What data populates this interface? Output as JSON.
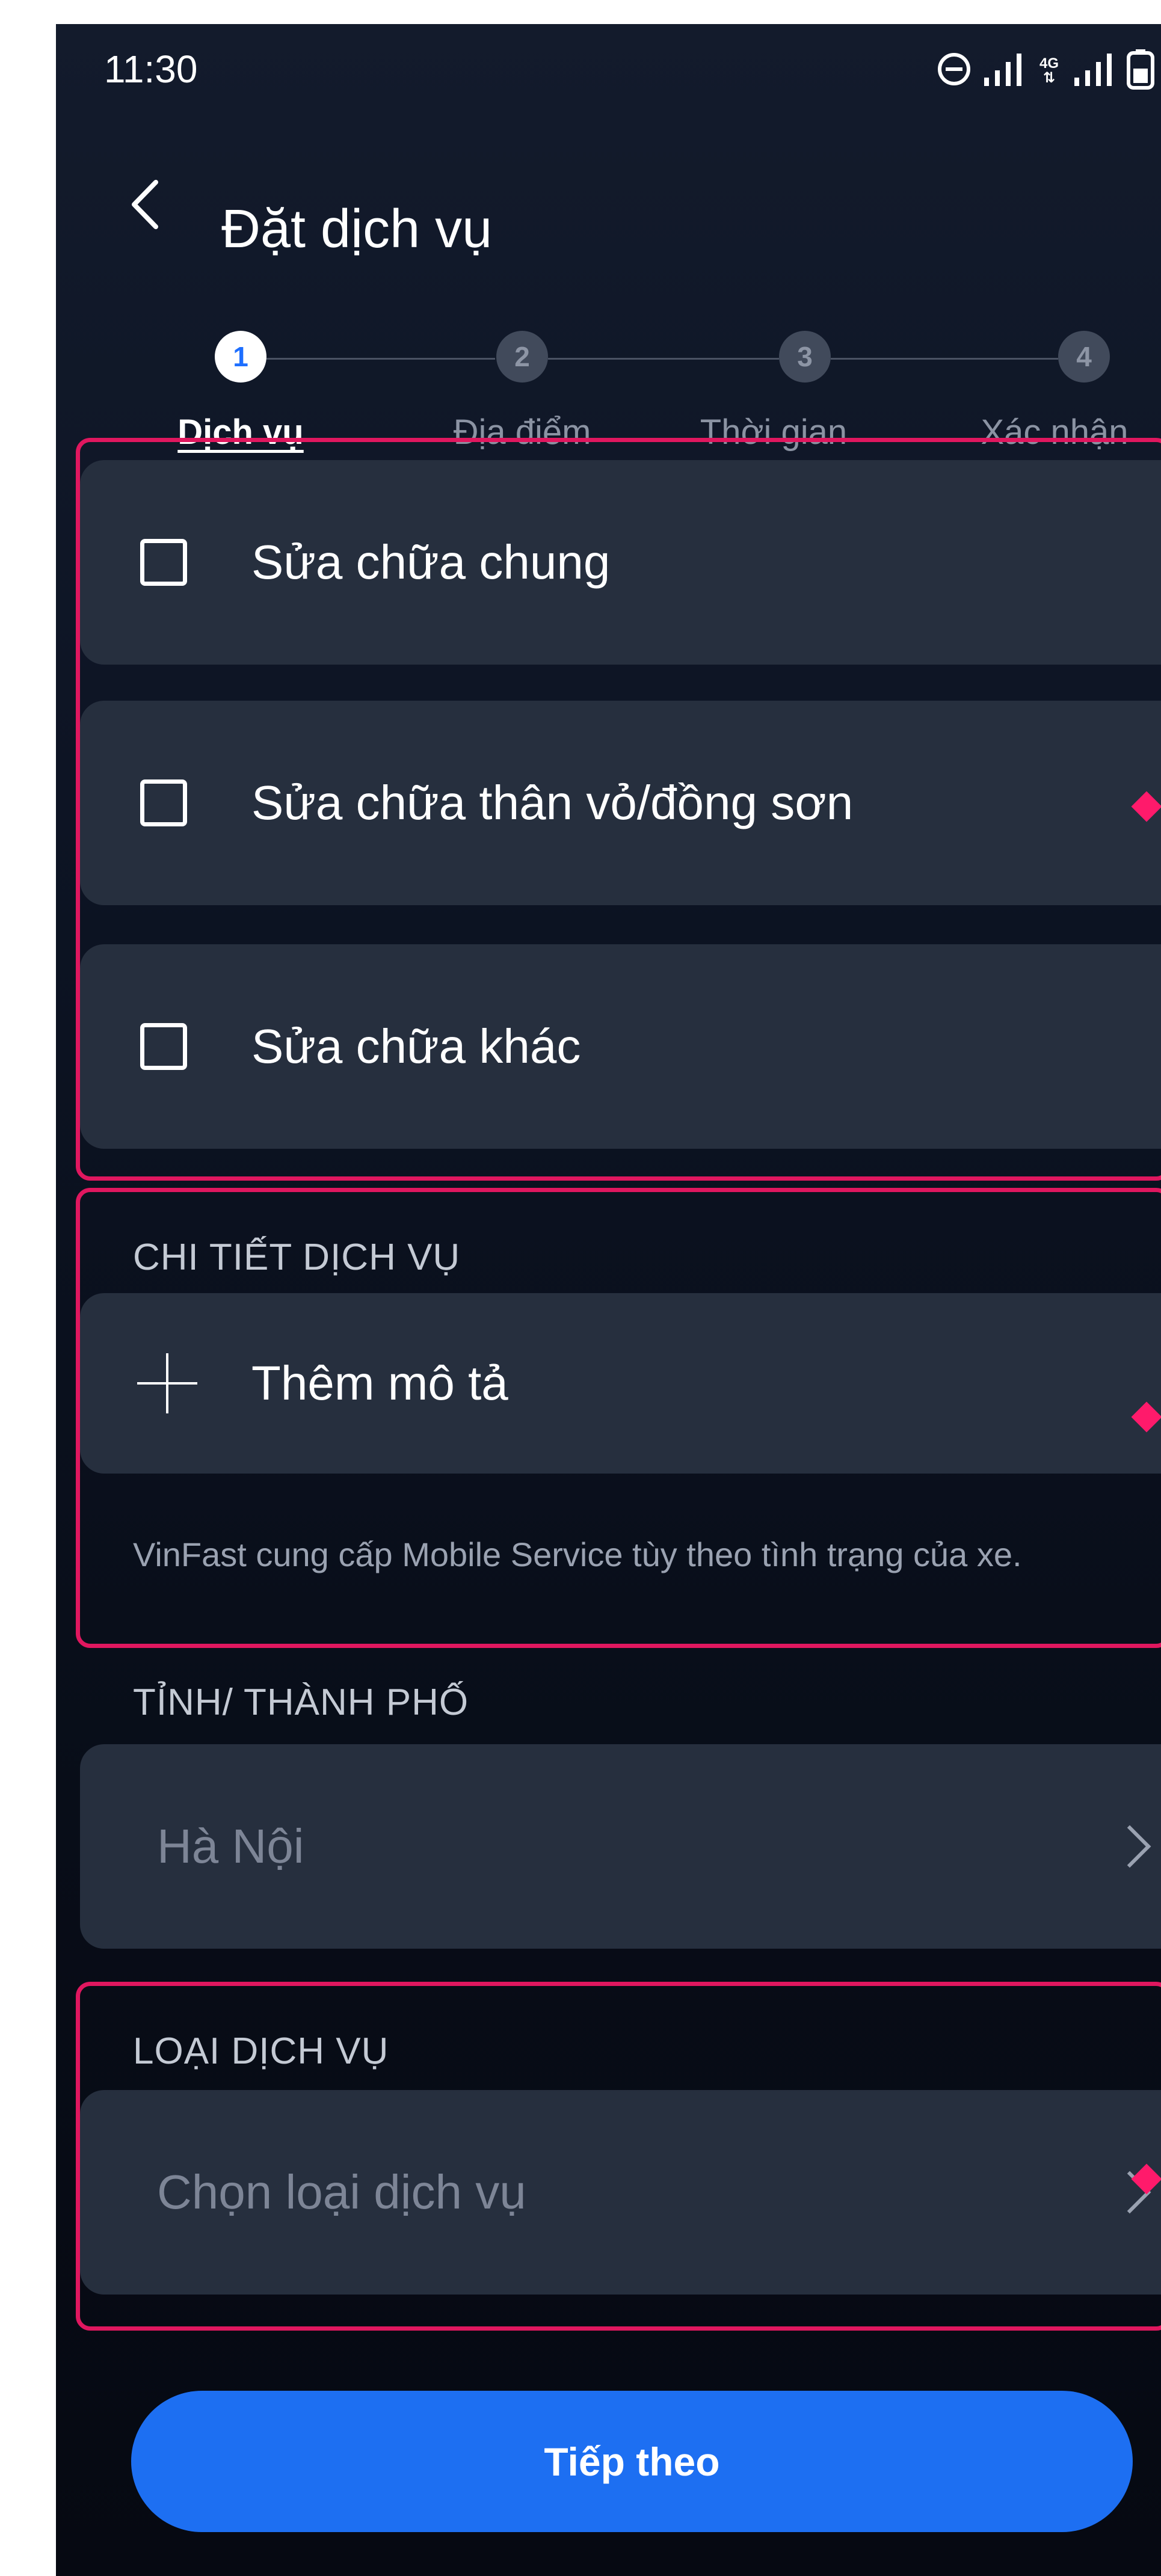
{
  "status_bar": {
    "time": "11:30",
    "icons": [
      "do-not-disturb-icon",
      "signal-icon",
      "4g-icon",
      "signal-icon",
      "battery-icon"
    ],
    "network_label": "4G"
  },
  "header": {
    "title": "Đặt dịch vụ",
    "back_icon": "chevron-left-icon"
  },
  "stepper": {
    "steps": [
      {
        "number": "1",
        "label": "Dịch vụ",
        "active": true
      },
      {
        "number": "2",
        "label": "Địa điểm",
        "active": false
      },
      {
        "number": "3",
        "label": "Thời gian",
        "active": false
      },
      {
        "number": "4",
        "label": "Xác nhận",
        "active": false
      }
    ]
  },
  "services": {
    "options": [
      {
        "label": "Sửa chữa chung",
        "checked": false
      },
      {
        "label": "Sửa chữa thân vỏ/đồng sơn",
        "checked": false
      },
      {
        "label": "Sửa chữa khác",
        "checked": false
      }
    ]
  },
  "details": {
    "section_label": "CHI TIẾT DỊCH VỤ",
    "add_label": "Thêm mô tả",
    "note": "VinFast cung cấp Mobile Service tùy theo tình trạng của xe."
  },
  "city": {
    "section_label": "TỈNH/ THÀNH PHỐ",
    "value": "Hà Nội"
  },
  "service_type": {
    "section_label": "LOẠI DỊCH VỤ",
    "placeholder": "Chọn loại dịch vụ"
  },
  "footer": {
    "next_label": "Tiếp theo"
  },
  "colors": {
    "accent": "#1d6ff2",
    "highlight": "#e0175f",
    "card": "#262f3e",
    "background": "#0d1424"
  }
}
